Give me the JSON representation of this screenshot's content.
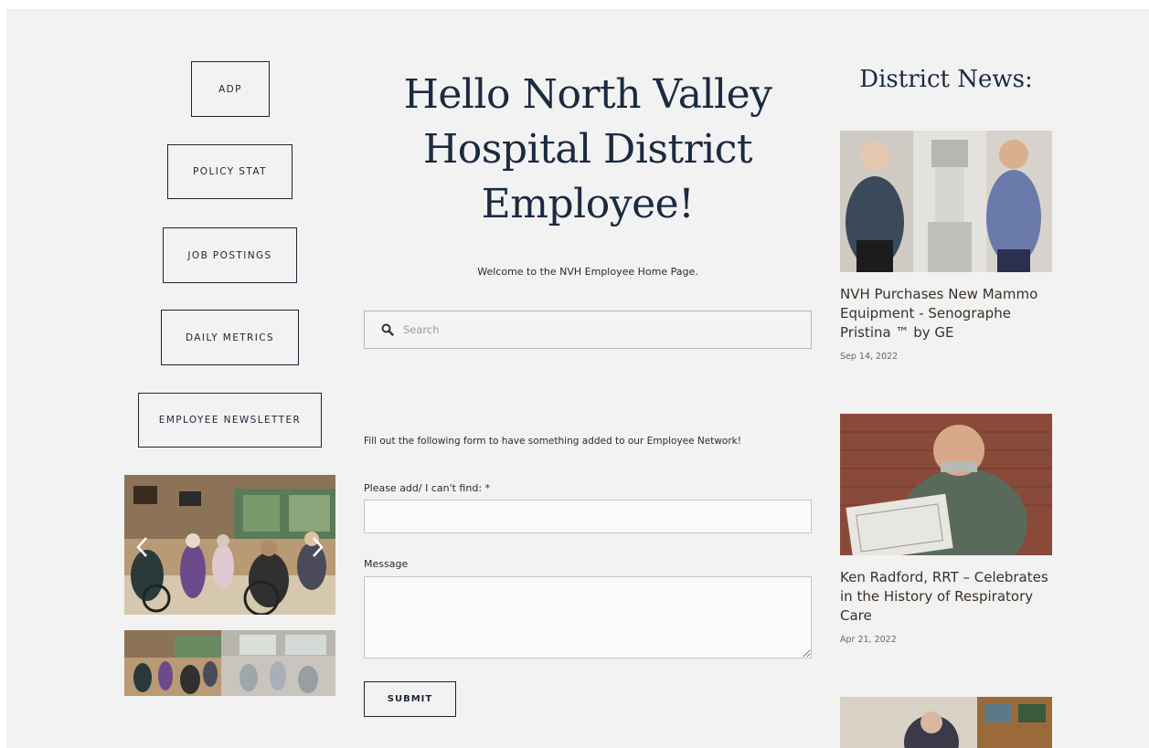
{
  "nav_buttons": [
    "ADP",
    "POLICY STAT",
    "JOB POSTINGS",
    "DAILY METRICS",
    "EMPLOYEE NEWSLETTER"
  ],
  "hero": {
    "title": "Hello North Valley Hospital District Employee!",
    "welcome": "Welcome to the NVH Employee Home Page."
  },
  "search": {
    "placeholder": "Search",
    "value": ""
  },
  "form": {
    "intro": "Fill out the following form to have something added to our Employee Network!",
    "field1_label": "Please add/ I can't find: *",
    "field1_value": "",
    "field2_label": "Message",
    "field2_value": "",
    "submit_label": "SUBMIT"
  },
  "news": {
    "heading": "District News:",
    "items": [
      {
        "title": "NVH Purchases New Mammo Equipment - Senographe Pristina ™ by GE",
        "date": "Sep 14, 2022"
      },
      {
        "title": "Ken Radford, RRT – Celebrates in the History of Respiratory Care",
        "date": "Apr 21, 2022"
      }
    ]
  },
  "colors": {
    "page_background": "#f2f2f2",
    "navy": "#1b2a40",
    "news_text": "#3b3026"
  },
  "icons": {
    "search": "search-icon",
    "prev": "chevron-left-icon",
    "next": "chevron-right-icon"
  }
}
